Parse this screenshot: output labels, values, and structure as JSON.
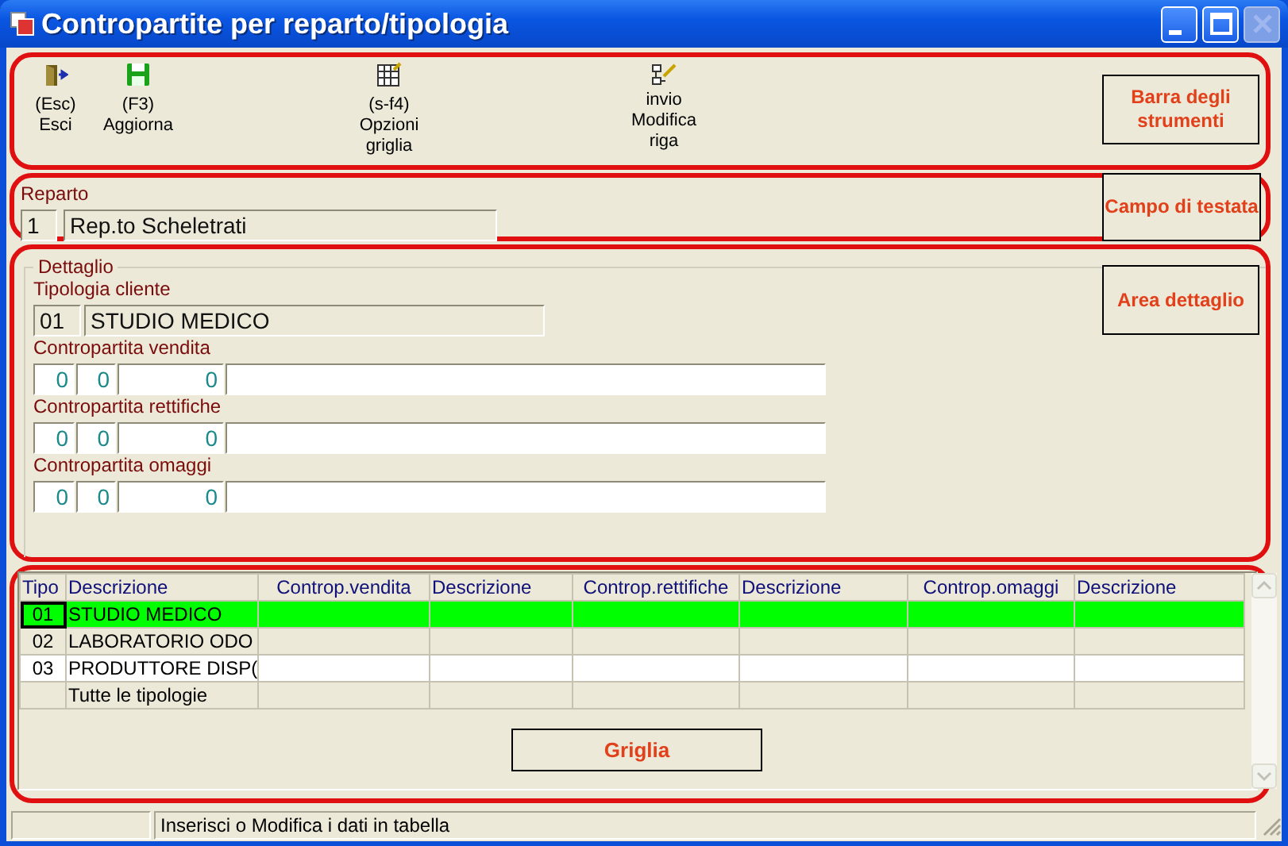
{
  "window": {
    "title": "Contropartite per reparto/tipologia",
    "controls": [
      {
        "kind": "minimize",
        "disabled": false
      },
      {
        "kind": "maximize",
        "disabled": false
      },
      {
        "kind": "close",
        "disabled": true
      }
    ]
  },
  "toolbar": {
    "buttons": [
      {
        "kind": "exit",
        "shortcut": "(Esc)",
        "label": "Esci"
      },
      {
        "kind": "save",
        "shortcut": "(F3)",
        "label": "Aggiorna"
      },
      {
        "kind": "grid",
        "shortcut": "(s-f4)",
        "label": "Opzioni griglia"
      },
      {
        "kind": "edit",
        "shortcut": "invio",
        "label": "Modifica riga"
      }
    ],
    "callout": "Barra degli strumenti"
  },
  "header": {
    "label": "Reparto",
    "code": "1",
    "name": "Rep.to Scheletrati",
    "callout": "Campo di testata"
  },
  "detail": {
    "legend": "Dettaglio",
    "callout": "Area dettaglio",
    "tipologia": {
      "label": "Tipologia cliente",
      "code": "01",
      "name": "STUDIO MEDICO"
    },
    "accounts": [
      {
        "label": "Contropartita vendita",
        "values": [
          "0",
          "0",
          "0"
        ]
      },
      {
        "label": "Contropartita rettifiche",
        "values": [
          "0",
          "0",
          "0"
        ]
      },
      {
        "label": "Contropartita omaggi",
        "values": [
          "0",
          "0",
          "0"
        ]
      }
    ]
  },
  "grid": {
    "columns": [
      "Tipo",
      "Descrizione",
      "Controp.vendita",
      "Descrizione",
      "Controp.rettifiche",
      "Descrizione",
      "Controp.omaggi",
      "Descrizione"
    ],
    "rows": [
      {
        "tipo": "01",
        "descrizione": "STUDIO MEDICO",
        "selected": true,
        "shaded": false
      },
      {
        "tipo": "02",
        "descrizione": "LABORATORIO ODO",
        "selected": false,
        "shaded": true
      },
      {
        "tipo": "03",
        "descrizione": "PRODUTTORE DISP(",
        "selected": false,
        "shaded": false
      },
      {
        "descrizione": "Tutte le tipologie",
        "selected": false,
        "shaded": true
      }
    ],
    "callout": "Griglia"
  },
  "status_bar": {
    "message": "Inserisci o Modifica i dati in tabella"
  }
}
